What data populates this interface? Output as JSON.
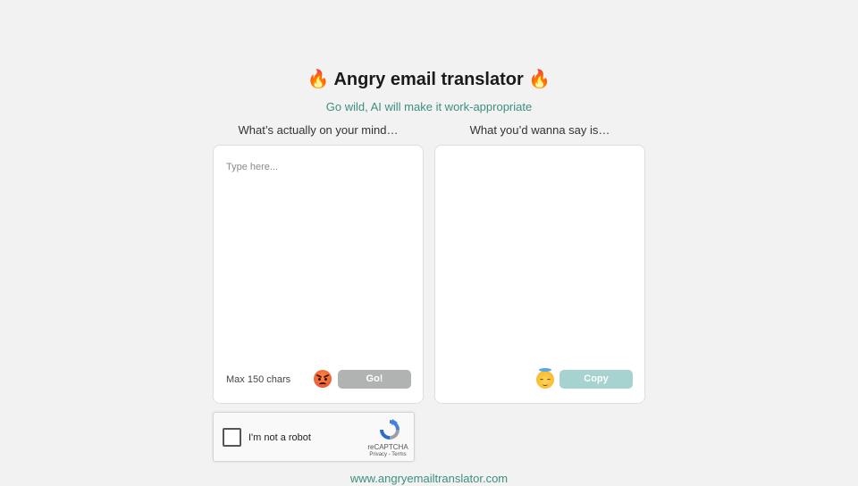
{
  "header": {
    "title": "Angry email translator",
    "title_emoji": "🔥",
    "subtitle": "Go wild, AI will make it work-appropriate"
  },
  "input_panel": {
    "label": "What’s actually on your mind…",
    "placeholder": "Type here...",
    "char_limit": "Max 150 chars",
    "face_icon": "angry-face-icon",
    "button_label": "Go!"
  },
  "output_panel": {
    "label": "What you’d wanna say is…",
    "face_icon": "angel-face-icon",
    "button_label": "Copy"
  },
  "recaptcha": {
    "label": "I'm not a robot",
    "brand": "reCAPTCHA",
    "privacy": "Privacy",
    "separator": " - ",
    "terms": "Terms"
  },
  "footer": {
    "link": "www.angryemailtranslator.com"
  },
  "colors": {
    "accent": "#3d8f7e",
    "go_button": "#b0b3b2",
    "copy_button": "#a6d2cf",
    "background": "#f2f2f2"
  }
}
